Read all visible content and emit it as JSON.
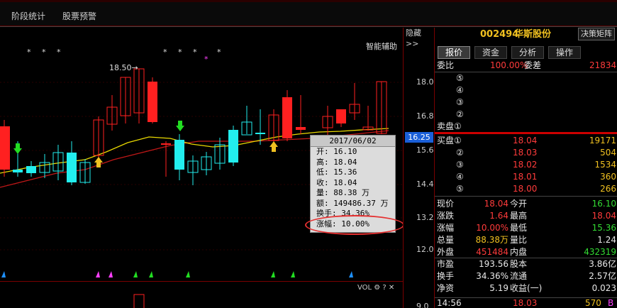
{
  "menu": {
    "items": [
      "阶段统计",
      "股票预警"
    ]
  },
  "chart": {
    "smart_assist": "智能辅助",
    "hide_btn": "隐藏>>",
    "annotation": "18.50→",
    "stars": "* * *",
    "star_single": "*",
    "vol_tools": "VOL ⚙ ? ✕",
    "price_ticks": [
      "18.0",
      "16.8",
      "15.6",
      "14.4",
      "13.2",
      "12.0",
      "9.0"
    ],
    "current_price_label": "16.25",
    "colors": {
      "up": "#ff2020",
      "down": "#22eeee",
      "ma_yellow": "#e8d800",
      "ma_red": "#c01818",
      "background": "#000000"
    }
  },
  "tooltip": {
    "date": "2017/06/02",
    "open": "开: 16.10",
    "high": "高: 18.04",
    "low": "低: 15.36",
    "close": "收: 18.04",
    "volume": "量: 88.38 万",
    "amount": "额: 149486.37 万",
    "turnover": "换手: 34.36%",
    "change": "涨幅: 10.00%"
  },
  "stock": {
    "code": "002494",
    "name": "华斯股份",
    "matrix_btn": "决策矩阵",
    "tabs": [
      "报价",
      "资金",
      "分析",
      "操作"
    ]
  },
  "order_book": {
    "weibi_label": "委比",
    "weibi_value": "100.00%",
    "weicha_label": "委差",
    "weicha_value": "21834",
    "sell_levels": [
      "⑤",
      "④",
      "③",
      "②",
      "卖盘①"
    ],
    "buy_levels": [
      {
        "label": "买盘①",
        "price": "18.04",
        "vol": "19171"
      },
      {
        "label": "②",
        "price": "18.03",
        "vol": "504"
      },
      {
        "label": "③",
        "price": "18.02",
        "vol": "1534"
      },
      {
        "label": "④",
        "price": "18.01",
        "vol": "360"
      },
      {
        "label": "⑤",
        "price": "18.00",
        "vol": "266"
      }
    ]
  },
  "quote": {
    "rows": [
      {
        "l1": "现价",
        "v1": "18.04",
        "l2": "今开",
        "v2": "16.10",
        "c1": "red",
        "c2": "grn"
      },
      {
        "l1": "涨跌",
        "v1": "1.64",
        "l2": "最高",
        "v2": "18.04",
        "c1": "red",
        "c2": "red"
      },
      {
        "l1": "涨幅",
        "v1": "10.00%",
        "l2": "最低",
        "v2": "15.36",
        "c1": "red",
        "c2": "grn"
      },
      {
        "l1": "总量",
        "v1": "88.38万",
        "l2": "量比",
        "v2": "1.24",
        "c1": "yel",
        "c2": "wht"
      },
      {
        "l1": "外盘",
        "v1": "451484",
        "l2": "内盘",
        "v2": "432319",
        "c1": "red",
        "c2": "grn"
      },
      {
        "l1": "市盈",
        "v1": "193.56",
        "l2": "股本",
        "v2": "3.86亿",
        "c1": "wht",
        "c2": "wht"
      },
      {
        "l1": "换手",
        "v1": "34.36%",
        "l2": "流通",
        "v2": "2.57亿",
        "c1": "wht",
        "c2": "wht"
      },
      {
        "l1": "净资",
        "v1": "5.19",
        "l2": "收益(一)",
        "v2": "0.023",
        "c1": "wht",
        "c2": "wht"
      }
    ]
  },
  "tick": {
    "time": "14:56",
    "price": "18.03",
    "vol": "570",
    "side": "B"
  }
}
